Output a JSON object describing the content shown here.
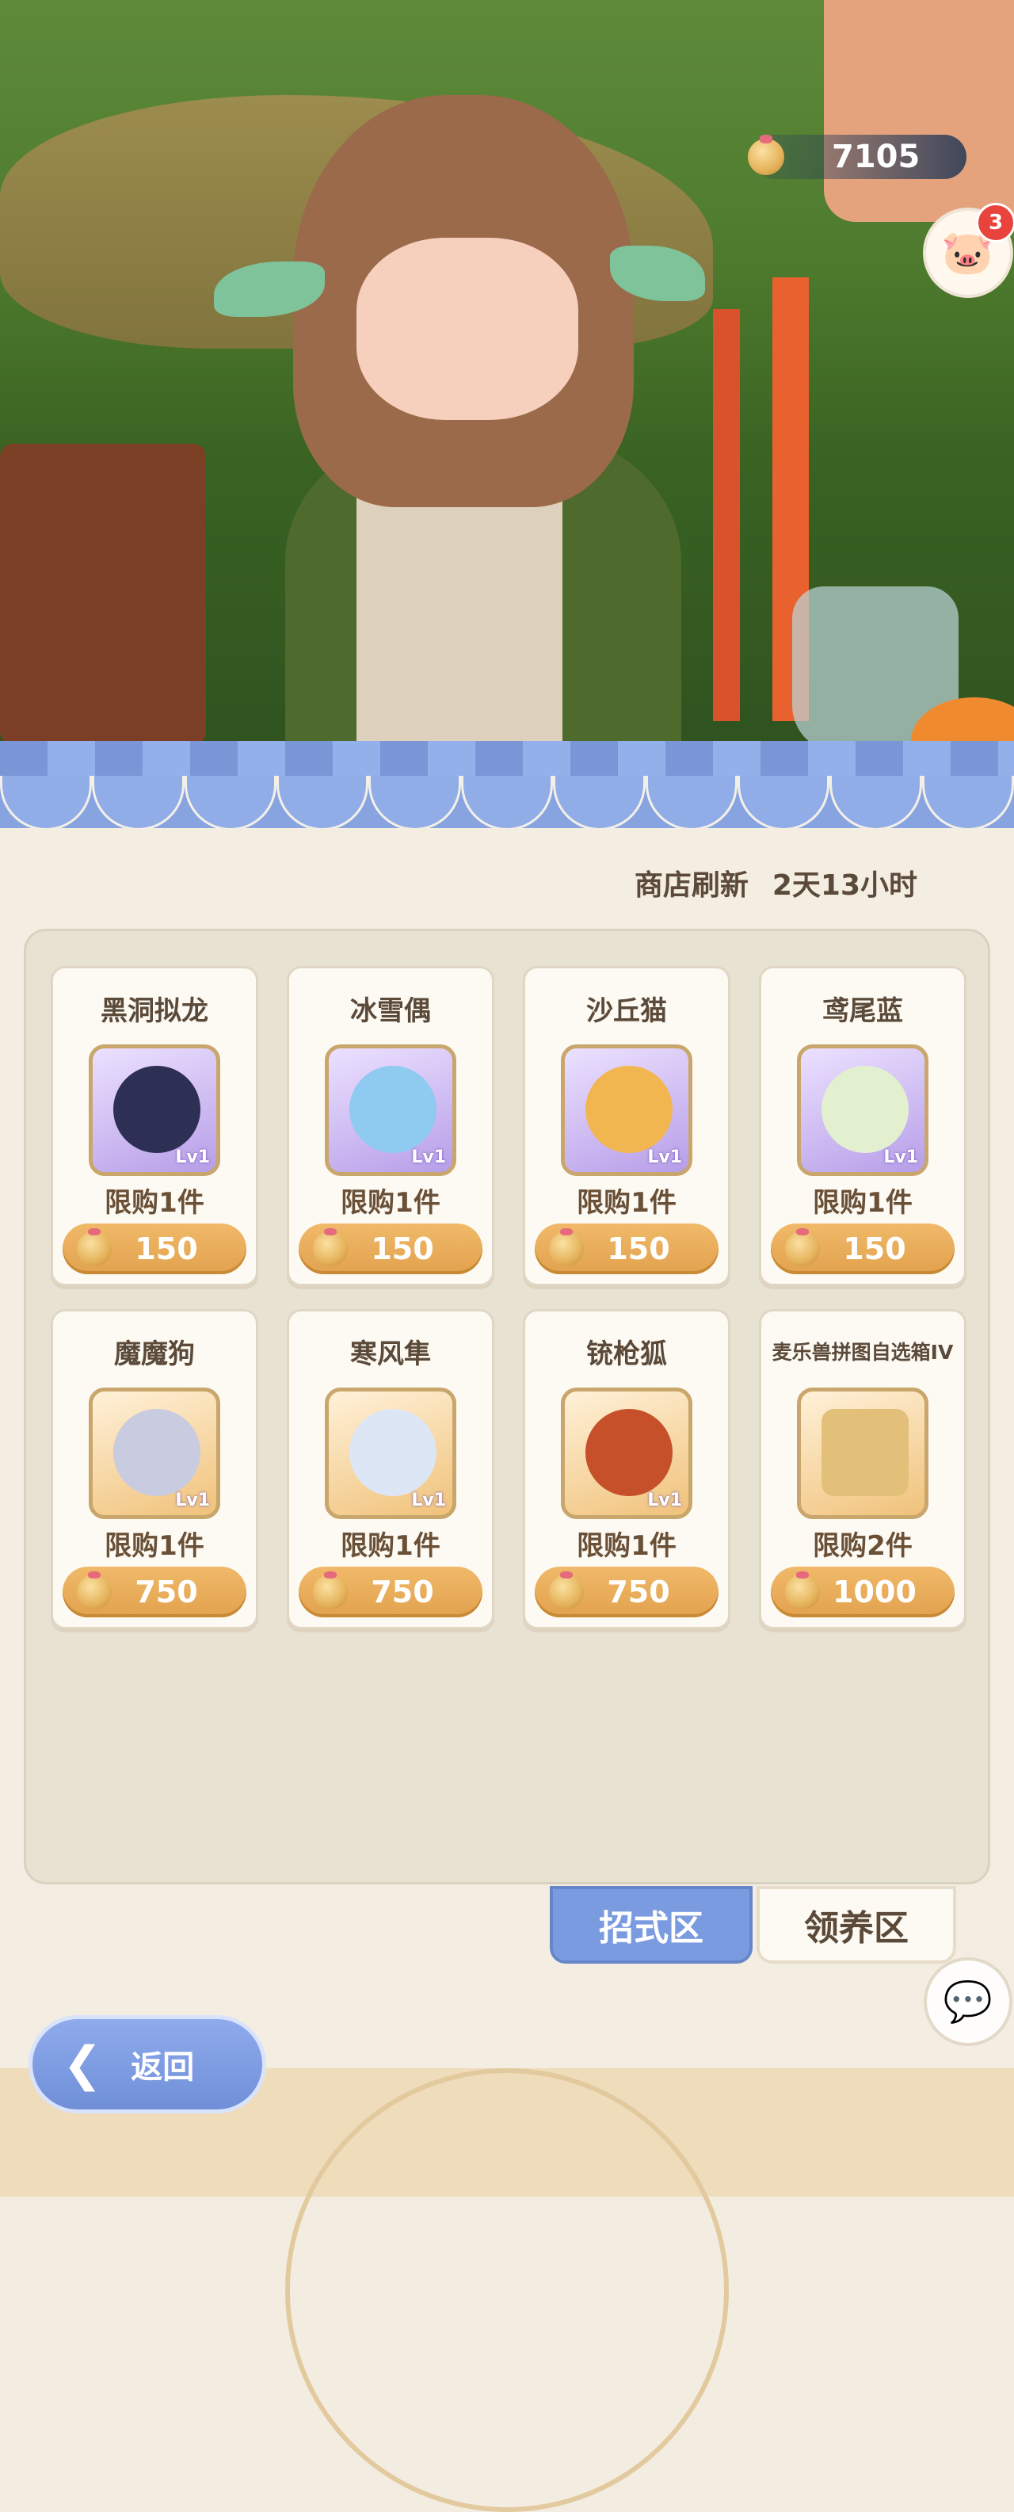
{
  "currency": {
    "amount": "7105"
  },
  "pet_button": {
    "badge": "3"
  },
  "shop": {
    "refresh_label": "商店刷新",
    "refresh_value": "2天13小时"
  },
  "items": [
    {
      "name": "黑洞拟龙",
      "limit": "限购1件",
      "price": "150",
      "level": "Lv1",
      "frame": "purple",
      "color": "#2e2f55"
    },
    {
      "name": "冰雪偶",
      "limit": "限购1件",
      "price": "150",
      "level": "Lv1",
      "frame": "purple",
      "color": "#8fcaf0"
    },
    {
      "name": "沙丘猫",
      "limit": "限购1件",
      "price": "150",
      "level": "Lv1",
      "frame": "purple",
      "color": "#f2b650"
    },
    {
      "name": "鸢尾蓝",
      "limit": "限购1件",
      "price": "150",
      "level": "Lv1",
      "frame": "purple",
      "color": "#e3f0d0"
    },
    {
      "name": "魔魔狗",
      "limit": "限购1件",
      "price": "750",
      "level": "Lv1",
      "frame": "orange",
      "color": "#c9cbe0"
    },
    {
      "name": "寒风隼",
      "limit": "限购1件",
      "price": "750",
      "level": "Lv1",
      "frame": "orange",
      "color": "#dde6f5"
    },
    {
      "name": "铳枪狐",
      "limit": "限购1件",
      "price": "750",
      "level": "Lv1",
      "frame": "orange",
      "color": "#c5502a"
    },
    {
      "name": "麦乐兽拼图自选箱IV",
      "limit": "限购2件",
      "price": "1000",
      "level": "",
      "frame": "orange",
      "color": "#e2c07a"
    }
  ],
  "tabs": {
    "active": "招式区",
    "inactive": "领养区"
  },
  "back": {
    "label": "返回"
  }
}
